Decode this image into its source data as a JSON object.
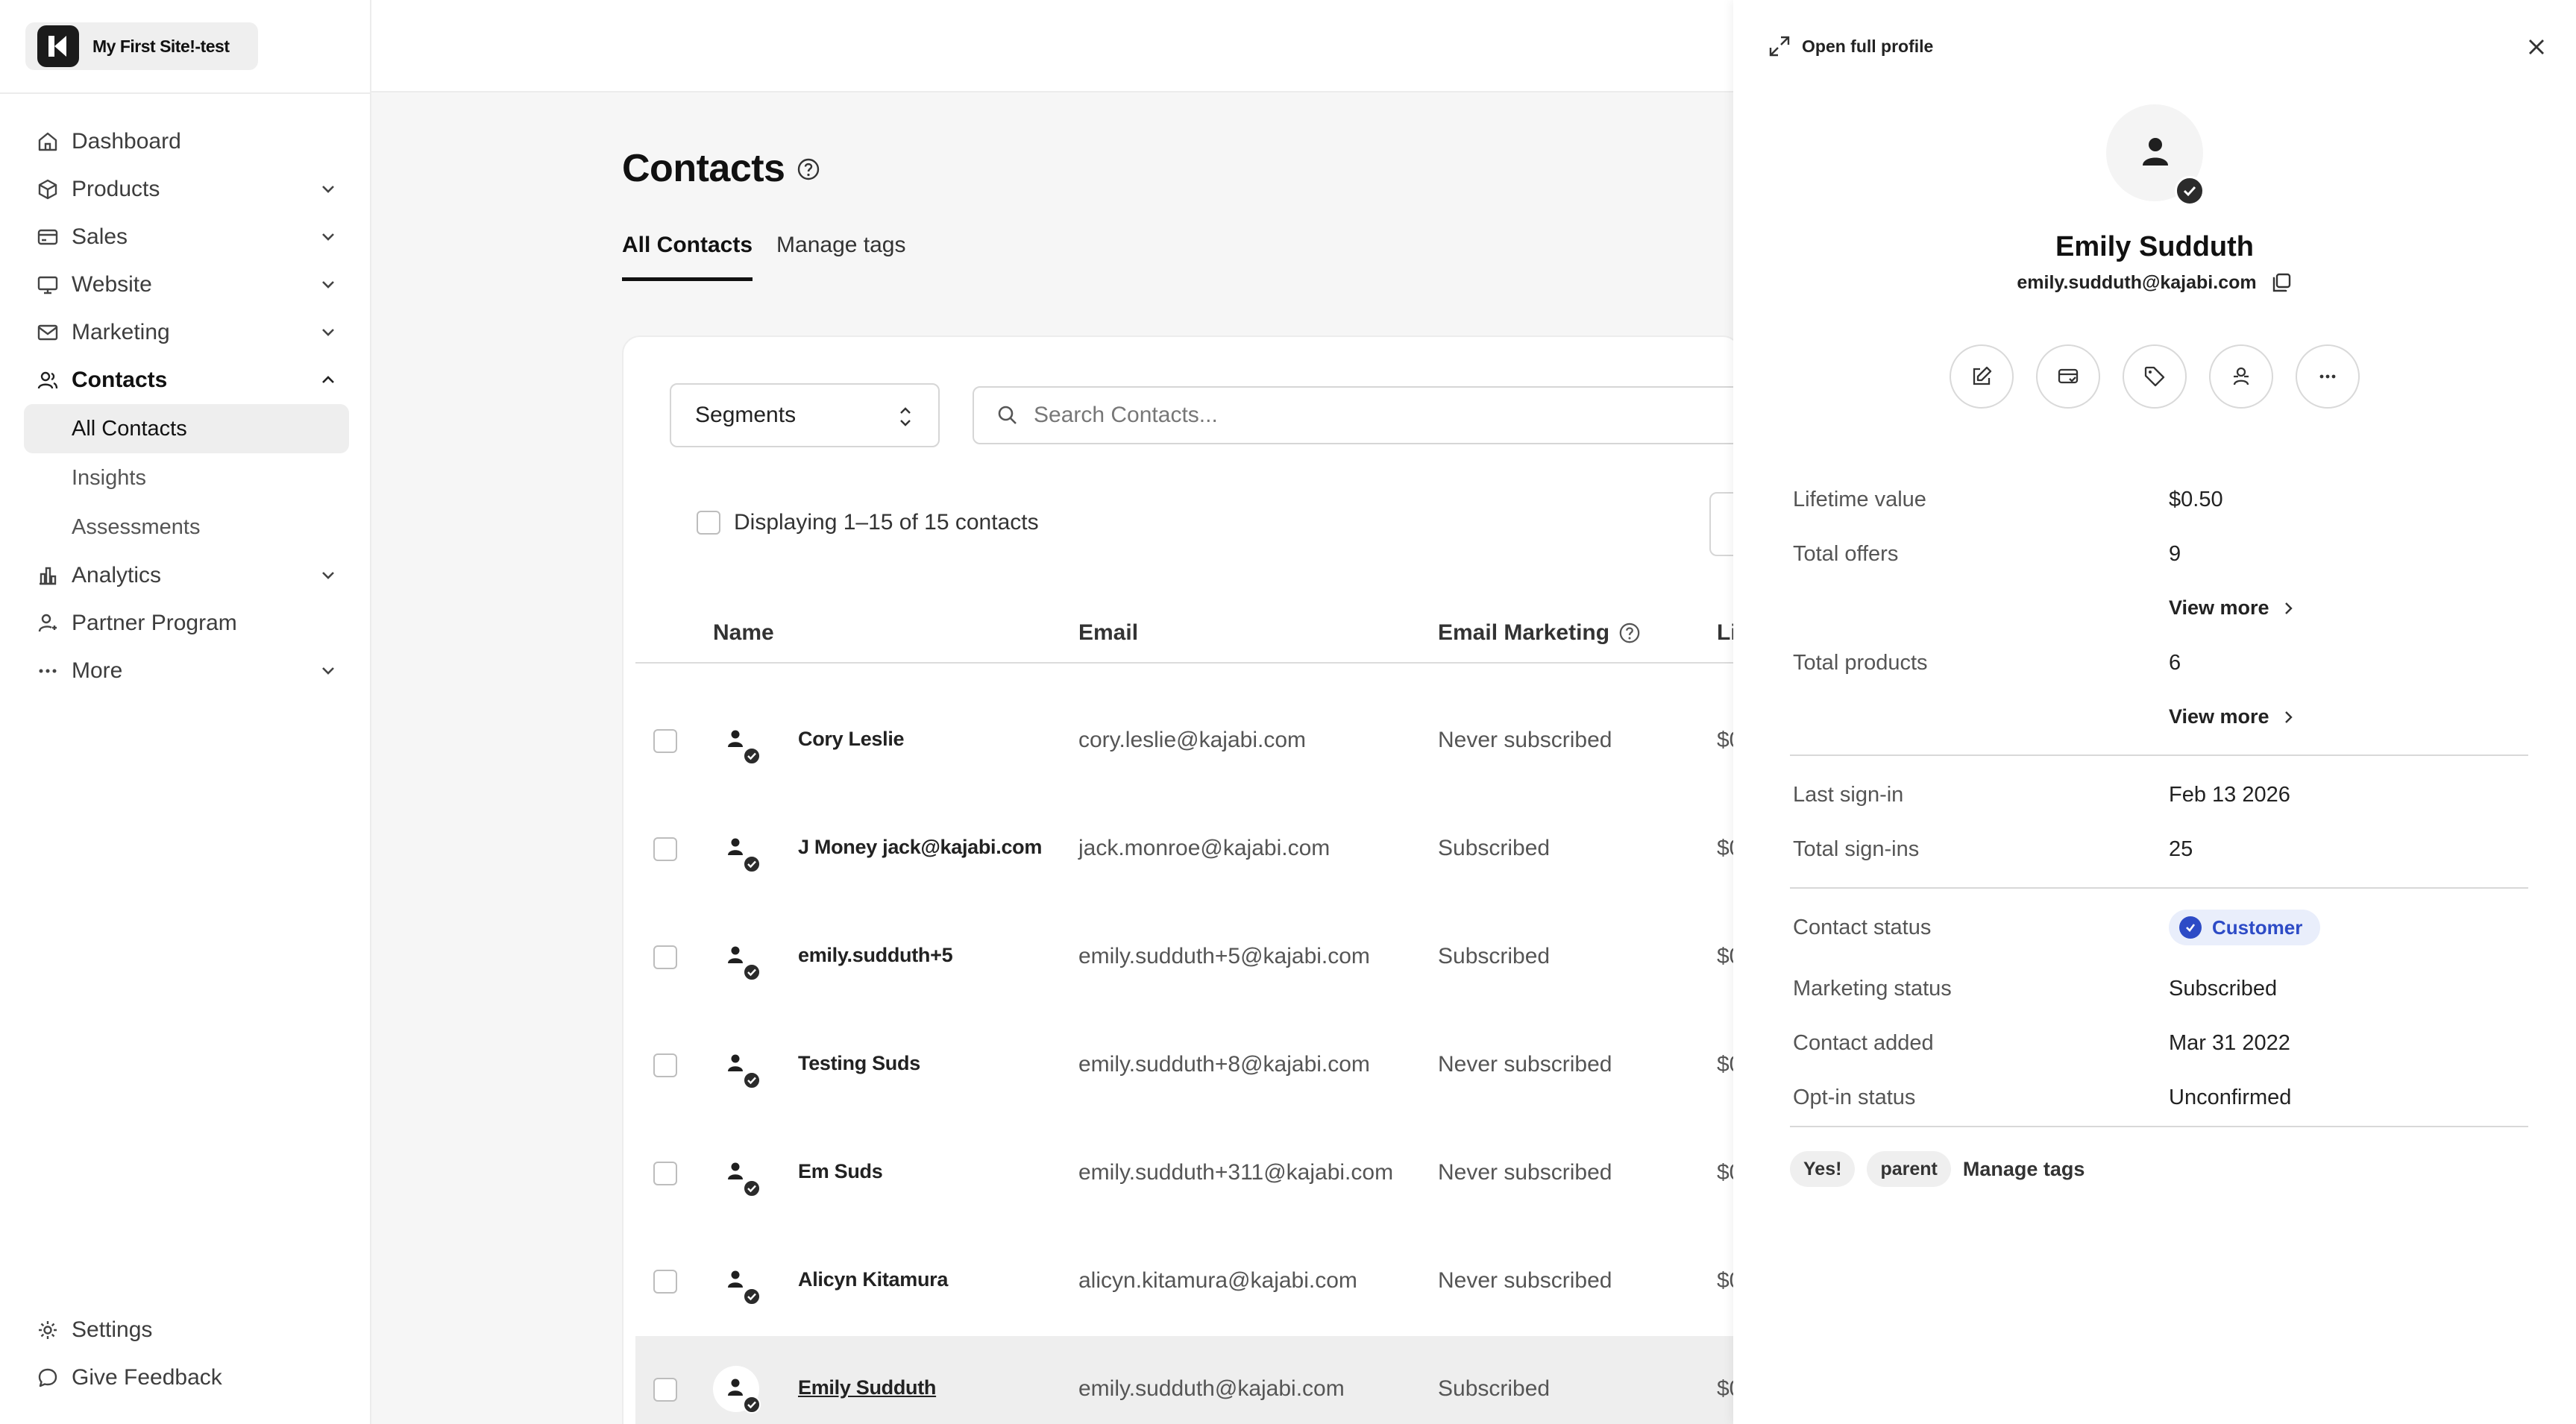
{
  "app": {
    "site_name": "My First Site!-test"
  },
  "sidebar": {
    "items": [
      {
        "label": "Dashboard",
        "icon": "home-icon"
      },
      {
        "label": "Products",
        "icon": "box-icon",
        "expandable": true
      },
      {
        "label": "Sales",
        "icon": "card-icon",
        "expandable": true
      },
      {
        "label": "Website",
        "icon": "monitor-icon",
        "expandable": true
      },
      {
        "label": "Marketing",
        "icon": "mail-icon",
        "expandable": true
      },
      {
        "label": "Contacts",
        "icon": "people-icon",
        "expanded": true
      },
      {
        "label": "Analytics",
        "icon": "chart-icon",
        "expandable": true
      },
      {
        "label": "Partner Program",
        "icon": "partner-icon"
      },
      {
        "label": "More",
        "icon": "dots-icon",
        "expandable": true
      }
    ],
    "contacts_sub": [
      "All Contacts",
      "Insights",
      "Assessments"
    ],
    "bottom": {
      "settings": "Settings",
      "feedback": "Give Feedback"
    }
  },
  "main": {
    "title": "Contacts",
    "tabs": [
      "All Contacts",
      "Manage tags"
    ],
    "segments_label": "Segments",
    "search_placeholder": "Search Contacts...",
    "display_text": "Displaying 1–15 of 15 contacts",
    "columns": {
      "name": "Name",
      "email": "Email",
      "marketing": "Email Marketing",
      "ltv": "Li"
    },
    "rows": [
      {
        "name": "Cory Leslie",
        "email": "cory.leslie@kajabi.com",
        "marketing": "Never subscribed",
        "ltv": "$0"
      },
      {
        "name": "J Money jack@kajabi.com",
        "email": "jack.monroe@kajabi.com",
        "marketing": "Subscribed",
        "ltv": "$0"
      },
      {
        "name": "emily.sudduth+5",
        "email": "emily.sudduth+5@kajabi.com",
        "marketing": "Subscribed",
        "ltv": "$0"
      },
      {
        "name": "Testing Suds",
        "email": "emily.sudduth+8@kajabi.com",
        "marketing": "Never subscribed",
        "ltv": "$0"
      },
      {
        "name": "Em Suds",
        "email": "emily.sudduth+311@kajabi.com",
        "marketing": "Never subscribed",
        "ltv": "$0"
      },
      {
        "name": "Alicyn Kitamura",
        "email": "alicyn.kitamura@kajabi.com",
        "marketing": "Never subscribed",
        "ltv": "$0"
      },
      {
        "name": "Emily Sudduth",
        "email": "emily.sudduth@kajabi.com",
        "marketing": "Subscribed",
        "ltv": "$0"
      }
    ]
  },
  "drawer": {
    "open_full": "Open full profile",
    "name": "Emily Sudduth",
    "email": "emily.sudduth@kajabi.com",
    "lifetime_value_label": "Lifetime value",
    "lifetime_value": "$0.50",
    "total_offers_label": "Total offers",
    "total_offers": "9",
    "view_more": "View more",
    "total_products_label": "Total products",
    "total_products": "6",
    "last_signin_label": "Last sign-in",
    "last_signin": "Feb 13 2026",
    "total_signins_label": "Total sign-ins",
    "total_signins": "25",
    "contact_status_label": "Contact status",
    "contact_status": "Customer",
    "marketing_status_label": "Marketing status",
    "marketing_status": "Subscribed",
    "contact_added_label": "Contact added",
    "contact_added": "Mar 31 2022",
    "optin_label": "Opt-in status",
    "optin": "Unconfirmed",
    "tags": [
      "Yes!",
      "parent"
    ],
    "manage_tags": "Manage tags"
  },
  "colors": {
    "accent_blue": "#2d4bc6",
    "badge_bg": "#e9eefb"
  }
}
